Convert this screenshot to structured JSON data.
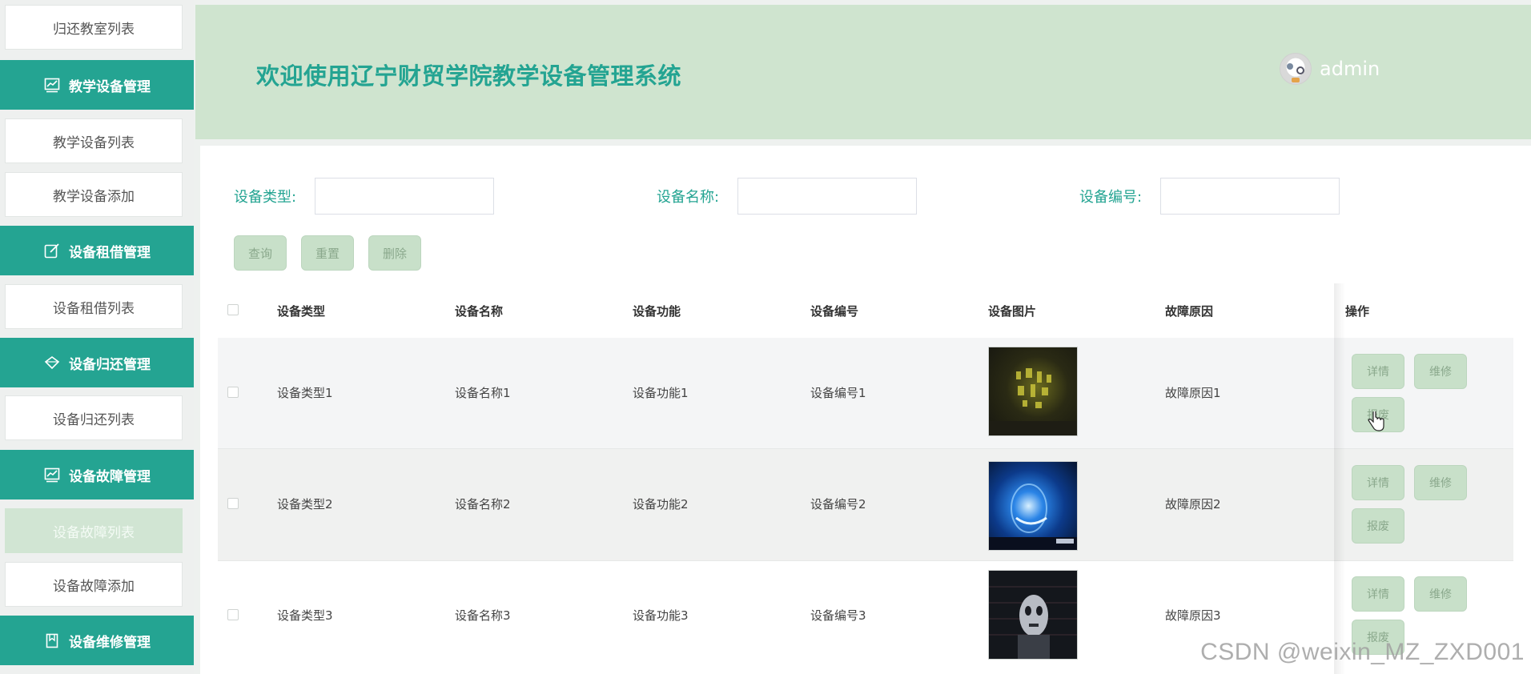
{
  "sidebar": {
    "items": [
      {
        "type": "sub",
        "label": "归还教室列表"
      },
      {
        "type": "group",
        "label": "教学设备管理",
        "icon": "chart-icon"
      },
      {
        "type": "sub",
        "label": "教学设备列表"
      },
      {
        "type": "sub",
        "label": "教学设备添加"
      },
      {
        "type": "group",
        "label": "设备租借管理",
        "icon": "edit-icon"
      },
      {
        "type": "sub",
        "label": "设备租借列表"
      },
      {
        "type": "group",
        "label": "设备归还管理",
        "icon": "diamond-icon"
      },
      {
        "type": "sub",
        "label": "设备归还列表"
      },
      {
        "type": "group",
        "label": "设备故障管理",
        "icon": "chart-icon"
      },
      {
        "type": "sub",
        "label": "设备故障列表",
        "active": true
      },
      {
        "type": "sub",
        "label": "设备故障添加"
      },
      {
        "type": "group",
        "label": "设备维修管理",
        "icon": "bookmark-icon"
      }
    ]
  },
  "header": {
    "title": "欢迎使用辽宁财贸学院教学设备管理系统",
    "username": "admin"
  },
  "search": {
    "type_label": "设备类型:",
    "name_label": "设备名称:",
    "code_label": "设备编号:",
    "type_value": "",
    "name_value": "",
    "code_value": ""
  },
  "actions": {
    "query": "查询",
    "reset": "重置",
    "delete": "删除"
  },
  "table": {
    "headers": [
      "设备类型",
      "设备名称",
      "设备功能",
      "设备编号",
      "设备图片",
      "故障原因",
      "操作"
    ],
    "rows": [
      {
        "type": "设备类型1",
        "name": "设备名称1",
        "function": "设备功能1",
        "code": "设备编号1",
        "reason": "故障原因1",
        "image": "dark-yellow-wall-thumbnail"
      },
      {
        "type": "设备类型2",
        "name": "设备名称2",
        "function": "设备功能2",
        "code": "设备编号2",
        "reason": "故障原因2",
        "image": "blue-glow-thumbnail"
      },
      {
        "type": "设备类型3",
        "name": "设备名称3",
        "function": "设备功能3",
        "code": "设备编号3",
        "reason": "故障原因3",
        "image": "dark-face-thumbnail"
      }
    ],
    "op_labels": {
      "detail": "详情",
      "repair": "维修",
      "scrap": "报废"
    }
  },
  "watermark": "CSDN @weixin_MZ_ZXD001",
  "colors": {
    "accent": "#24a492",
    "header_bg": "#cfe4cf",
    "button_bg": "#c8e0c9",
    "button_text": "#8aa88c"
  }
}
